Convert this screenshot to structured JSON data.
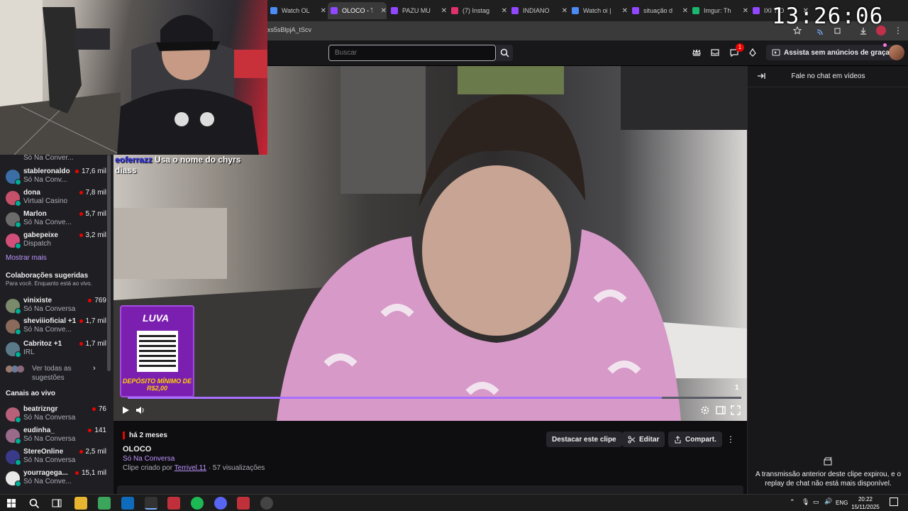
{
  "browser": {
    "tabs": [
      {
        "label": "Watch OL",
        "color": "#4c8bf5"
      },
      {
        "label": "OLOCO - T",
        "color": "#9146ff",
        "active": true
      },
      {
        "label": "PAZU MU",
        "color": "#9146ff"
      },
      {
        "label": "(7) Instag",
        "color": "#e1306c"
      },
      {
        "label": "INDIANO",
        "color": "#9146ff"
      },
      {
        "label": "Watch oi |",
        "color": "#4c8bf5"
      },
      {
        "label": "situação d",
        "color": "#9146ff"
      },
      {
        "label": "Imgur: Th",
        "color": "#1bb76e"
      },
      {
        "label": "IXI TIO",
        "color": "#9146ff"
      }
    ],
    "url_fragment": "xs5sBlpjA_tScv"
  },
  "overlay": {
    "clock": "13:26:06"
  },
  "topnav": {
    "search_placeholder": "Buscar",
    "notification_count": "1",
    "turbo_label": "Assista sem anúncios de graça"
  },
  "sidebar": {
    "partial_top_game": "Só Na Conver...",
    "followed": [
      {
        "name": "stableronaldo",
        "game": "Só Na Conv...",
        "viewers": "17,6 mil",
        "color": "#3a6ea5"
      },
      {
        "name": "dona",
        "game": "Virtual Casino",
        "viewers": "7,8 mil",
        "color": "#c4506a"
      },
      {
        "name": "Marlon",
        "game": "Só Na Conve...",
        "viewers": "5,7 mil",
        "color": "#6b6b6b"
      },
      {
        "name": "gabepeixe",
        "game": "Dispatch",
        "viewers": "3,2 mil",
        "color": "#d24f7a"
      }
    ],
    "show_more": "Mostrar mais",
    "suggested_title": "Colaborações sugeridas",
    "suggested_sub": "Para você. Enquanto está ao vivo.",
    "suggested": [
      {
        "name": "vinixiste",
        "game": "Só Na Conversa",
        "viewers": "769",
        "color": "#7a8a6a"
      },
      {
        "name": "sheviiioficial +1",
        "game": "Só Na Conve...",
        "viewers": "1,7 mil",
        "color": "#8a6a5a"
      },
      {
        "name": "Cabritoz +1",
        "game": "IRL",
        "viewers": "1,7 mil",
        "color": "#5a7a8a"
      }
    ],
    "see_all": "Ver todas as sugestões",
    "live_title": "Canais ao vivo",
    "live": [
      {
        "name": "beatrizngr",
        "game": "Só Na Conversa",
        "viewers": "76",
        "color": "#b8607a"
      },
      {
        "name": "eudinha_",
        "game": "Só Na Conversa",
        "viewers": "141",
        "color": "#9a6a8a"
      },
      {
        "name": "StereOnline",
        "game": "Só Na Conversa",
        "viewers": "2,5 mil",
        "color": "#3a3a8a"
      },
      {
        "name": "yourragega...",
        "game": "Só Na Conve...",
        "viewers": "15,1 mil",
        "color": "#e8e8e8"
      }
    ]
  },
  "video": {
    "chat_user": "eoferrazz",
    "chat_text": "Usa o nome do chyrs",
    "chat_text2": "diass",
    "promo_logo": "LUVA",
    "promo_sub": "DEPÓSITO MÍNIMO DE R$2,00",
    "count": "1",
    "progress": 0.87
  },
  "clip": {
    "time_ago": "há 2 meses",
    "title": "OLOCO",
    "category": "Só Na Conversa",
    "created_prefix": "Clipe criado por",
    "creator": "Terrivel.11",
    "views": "· 57 visualizações",
    "highlight_btn": "Destacar este clipe",
    "edit_btn": "Editar",
    "share_btn": "Compart."
  },
  "chat": {
    "title": "Fale no chat em vídeos",
    "expired_msg": "A transmissão anterior deste clipe expirou, e o replay de chat não está mais disponível."
  },
  "taskbar": {
    "lang": "ENG",
    "time": "20:22",
    "date": "15/11/2025"
  }
}
